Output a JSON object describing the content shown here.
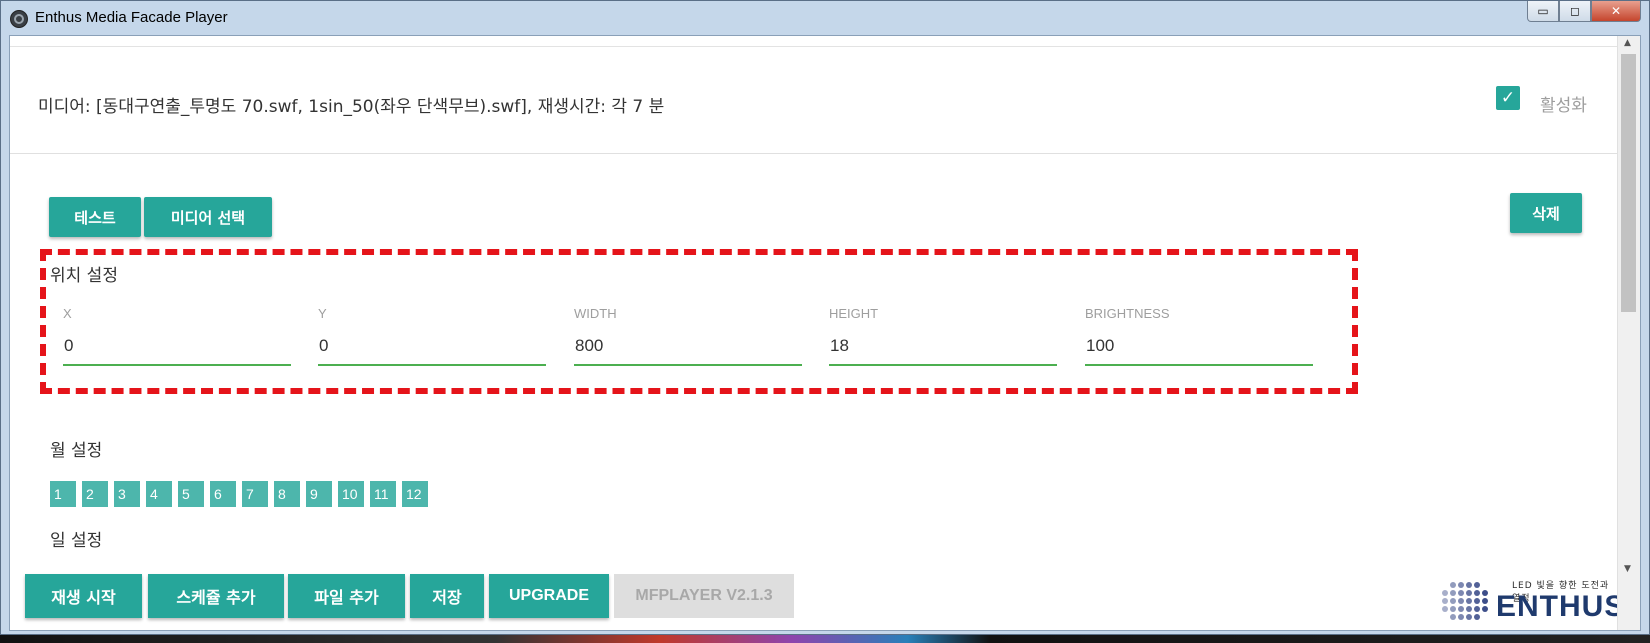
{
  "window": {
    "title": "Enthus Media Facade Player",
    "controls": {
      "minimize": "▭",
      "maximize": "◻",
      "close": "✕"
    }
  },
  "header": {
    "media_summary": "미디어: [동대구연출_투명도 70.swf, 1sin_50(좌우 단색무브).swf], 재생시간: 각 7 분",
    "activate_label": "활성화",
    "activate_checked": true
  },
  "actions": {
    "test_label": "테스트",
    "media_select_label": "미디어 선택",
    "delete_label": "삭제"
  },
  "position": {
    "title": "위치 설정",
    "fields": [
      {
        "label": "X",
        "value": "0"
      },
      {
        "label": "Y",
        "value": "0"
      },
      {
        "label": "WIDTH",
        "value": "800"
      },
      {
        "label": "HEIGHT",
        "value": "18"
      },
      {
        "label": "BRIGHTNESS",
        "value": "100"
      }
    ]
  },
  "months": {
    "title": "월 설정",
    "items": [
      "1",
      "2",
      "3",
      "4",
      "5",
      "6",
      "7",
      "8",
      "9",
      "10",
      "11",
      "12"
    ]
  },
  "days": {
    "title": "일 설정"
  },
  "footer": {
    "play_label": "재생 시작",
    "schedule_label": "스케쥴 추가",
    "file_add_label": "파일 추가",
    "save_label": "저장",
    "upgrade_label": "UPGRADE",
    "version_label": "MFPLAYER V2.1.3"
  },
  "logo": {
    "tagline": "LED 빛을 향한 도전과 열정",
    "word": "ENTHUS"
  },
  "colors": {
    "accent": "#26a69a",
    "month_chip": "#4db6ac",
    "field_underline": "#4caf50",
    "highlight": "#e5141a",
    "disabled": "#dedede"
  },
  "icons": {
    "app": "app-icon",
    "checkbox": "check-icon",
    "scroll_up": "scroll-up-icon",
    "scroll_down": "scroll-down-icon",
    "logo_mark": "enthus-logo-mark"
  }
}
